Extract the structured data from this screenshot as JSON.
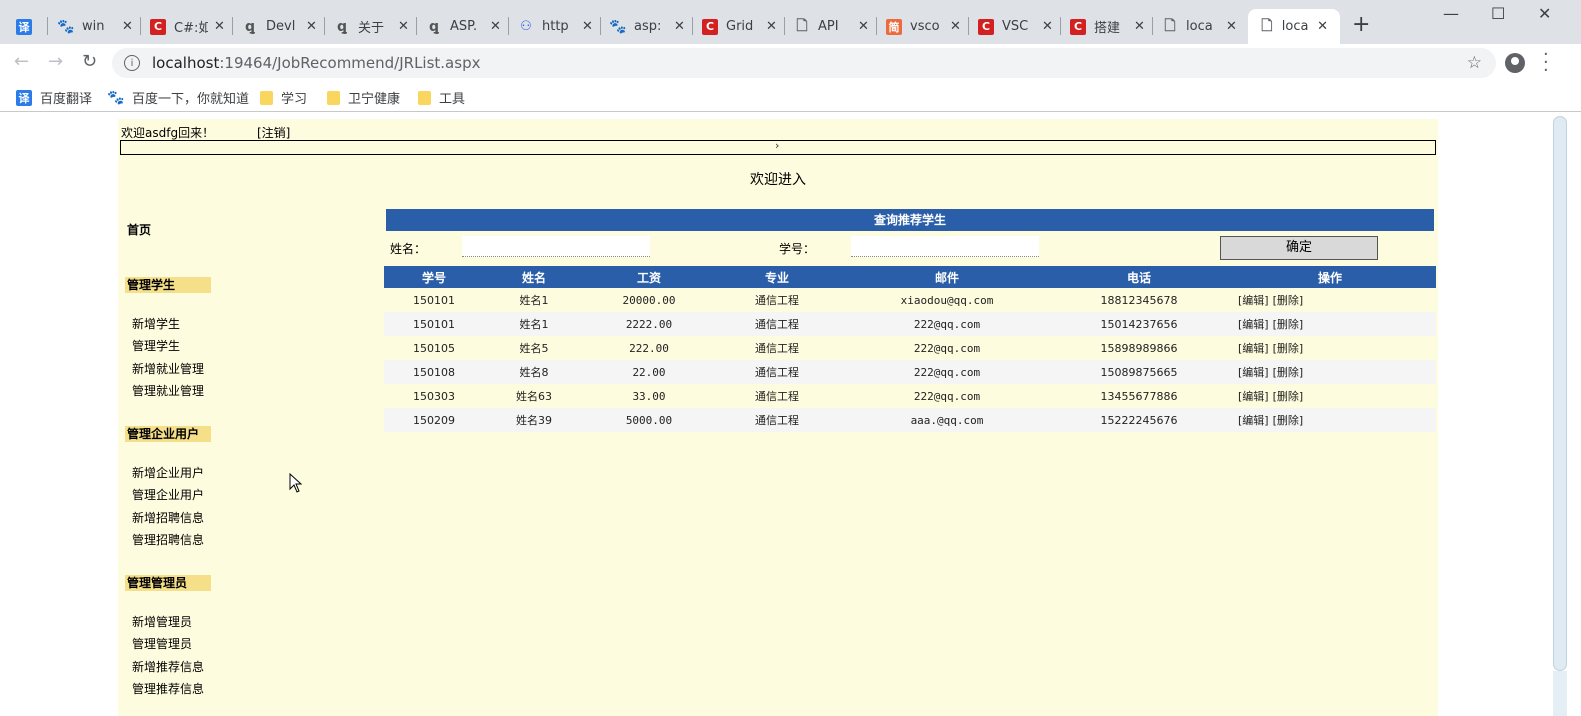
{
  "browser": {
    "tabs": [
      {
        "icon": "translate-icon",
        "glyph": "译",
        "cls": "fy",
        "title": "",
        "pinned": true
      },
      {
        "icon": "baidu-paw-icon",
        "glyph": "🐾",
        "cls": "bd",
        "title": "win"
      },
      {
        "icon": "csdn-icon",
        "glyph": "C",
        "cls": "cs",
        "title": "C#:如"
      },
      {
        "icon": "devexpress-icon",
        "glyph": "ꝗ",
        "cls": "dv",
        "title": "Devl"
      },
      {
        "icon": "devexpress-icon",
        "glyph": "ꝗ",
        "cls": "dv",
        "title": "关于"
      },
      {
        "icon": "devexpress-icon",
        "glyph": "ꝗ",
        "cls": "dv",
        "title": "ASP."
      },
      {
        "icon": "http-icon",
        "glyph": "⚇",
        "cls": "ht",
        "title": "http"
      },
      {
        "icon": "baidu-paw-icon",
        "glyph": "🐾",
        "cls": "bd",
        "title": "asp:"
      },
      {
        "icon": "csdn-icon",
        "glyph": "C",
        "cls": "cs",
        "title": "Grid"
      },
      {
        "icon": "page-icon",
        "glyph": "🗋",
        "cls": "pg",
        "title": "API"
      },
      {
        "icon": "jianshu-icon",
        "glyph": "简",
        "cls": "jz",
        "title": "vsco"
      },
      {
        "icon": "csdn-icon",
        "glyph": "C",
        "cls": "cs",
        "title": "VSC"
      },
      {
        "icon": "csdn-icon",
        "glyph": "C",
        "cls": "cs",
        "title": "搭建"
      },
      {
        "icon": "page-icon",
        "glyph": "🗋",
        "cls": "pg",
        "title": "loca"
      },
      {
        "icon": "page-icon",
        "glyph": "🗋",
        "cls": "pg",
        "title": "loca",
        "active": true
      }
    ],
    "new_tab": "+",
    "window": {
      "minimize": "—",
      "maximize": "☐",
      "close": "✕"
    },
    "nav": {
      "back": "←",
      "forward": "→",
      "reload": "↻"
    },
    "url_host": "localhost",
    "url_rest": ":19464/JobRecommend/JRList.aspx",
    "bookmarks": [
      {
        "icon": "translate-icon",
        "label": "百度翻译"
      },
      {
        "icon": "baidu-paw-icon",
        "label": "百度一下，你就知道"
      },
      {
        "icon": "folder-icon",
        "label": "学习"
      },
      {
        "icon": "folder-icon",
        "label": "卫宁健康"
      },
      {
        "icon": "folder-icon",
        "label": "工具"
      }
    ]
  },
  "page": {
    "welcome": "欢迎asdfg回来！",
    "logout": "[注销]",
    "collapse_arrow": "›",
    "title": "欢迎进入",
    "sidebar": {
      "home": "首页",
      "groups": [
        {
          "title": "管理学生",
          "items": [
            "新增学生",
            "管理学生",
            "新增就业管理",
            "管理就业管理"
          ]
        },
        {
          "title": "管理企业用户",
          "items": [
            "新增企业用户",
            "管理企业用户",
            "新增招聘信息",
            "管理招聘信息"
          ]
        },
        {
          "title": "管理管理员",
          "items": [
            "新增管理员",
            "管理管理员",
            "新增推荐信息",
            "管理推荐信息"
          ]
        }
      ]
    },
    "query": {
      "header": "查询推荐学生",
      "name_label": "姓名：",
      "name_value": "",
      "id_label": "学号：",
      "id_value": "",
      "submit": "确定"
    },
    "table": {
      "columns": [
        "学号",
        "姓名",
        "工资",
        "专业",
        "邮件",
        "电话",
        "操作"
      ],
      "rows": [
        {
          "id": "150101",
          "name": "姓名1",
          "salary": "20000.00",
          "major": "通信工程",
          "email": "xiaodou@qq.com",
          "phone": "18812345678"
        },
        {
          "id": "150101",
          "name": "姓名1",
          "salary": "2222.00",
          "major": "通信工程",
          "email": "222@qq.com",
          "phone": "15014237656"
        },
        {
          "id": "150105",
          "name": "姓名5",
          "salary": "222.00",
          "major": "通信工程",
          "email": "222@qq.com",
          "phone": "15898989866"
        },
        {
          "id": "150108",
          "name": "姓名8",
          "salary": "22.00",
          "major": "通信工程",
          "email": "222@qq.com",
          "phone": "15089875665"
        },
        {
          "id": "150303",
          "name": "姓名63",
          "salary": "33.00",
          "major": "通信工程",
          "email": "222@qq.com",
          "phone": "13455677886"
        },
        {
          "id": "150209",
          "name": "姓名39",
          "salary": "5000.00",
          "major": "通信工程",
          "email": "aaa.@qq.com",
          "phone": "15222245676"
        }
      ],
      "edit_label": "[编辑]",
      "delete_label": "[删除]"
    },
    "colors": {
      "header_blue": "#2a5ea9",
      "page_bg": "#fefcde",
      "group_bg": "#f5e089"
    }
  }
}
